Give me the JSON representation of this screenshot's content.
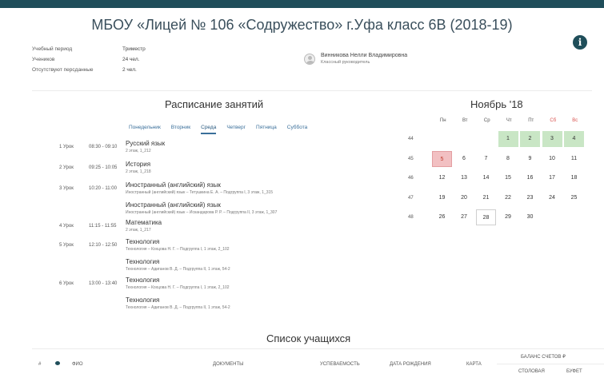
{
  "title": "МБОУ «Лицей № 106 «Содружество» г.Уфа класс 6В (2018-19)",
  "info_icon": "info-icon",
  "meta": [
    {
      "label": "Учебный период",
      "value": "Триместр"
    },
    {
      "label": "Учеников",
      "value": "24 чел."
    },
    {
      "label": "Отсутствуют персданные",
      "value": "2 чел."
    }
  ],
  "teacher": {
    "name": "Винникова Нелли Владимировна",
    "role": "Классный руководитель",
    "icon": "avatar-icon"
  },
  "schedule": {
    "title": "Расписание занятий",
    "tabs": [
      "Понедельник",
      "Вторник",
      "Среда",
      "Четверг",
      "Пятница",
      "Суббота"
    ],
    "active_tab": "Среда",
    "lessons": [
      {
        "num": "1 Урок",
        "time": "08:30 - 09:10",
        "entries": [
          {
            "name": "Русский язык",
            "detail": "2 этаж, 1_212"
          }
        ]
      },
      {
        "num": "2 Урок",
        "time": "09:25 - 10:05",
        "entries": [
          {
            "name": "История",
            "detail": "2 этаж, 1_218"
          }
        ]
      },
      {
        "num": "3 Урок",
        "time": "10:20 - 11:00",
        "entries": [
          {
            "name": "Иностранный (английский) язык",
            "detail": "Иностранный (английский) язык – Тетушкина Е. А. – Подгруппа I, 3 этаж, 1_315"
          },
          {
            "name": "Иностранный (английский) язык",
            "detail": "Иностранный (английский) язык – Искандарова Р. Р. – Подгруппа II, 3 этаж, 1_307"
          }
        ]
      },
      {
        "num": "4 Урок",
        "time": "11:15 - 11:55",
        "entries": [
          {
            "name": "Математика",
            "detail": "2 этаж, 1_217"
          }
        ]
      },
      {
        "num": "5 Урок",
        "time": "12:10 - 12:50",
        "entries": [
          {
            "name": "Технология",
            "detail": "Технология – Кохцова Н. Г. – Подгруппа I, 1 этаж, 2_102"
          },
          {
            "name": "Технология",
            "detail": "Технология – Адиганов В. Д. – Подгруппа II, 1 этаж, 54-2"
          }
        ]
      },
      {
        "num": "6 Урок",
        "time": "13:00 - 13:40",
        "entries": [
          {
            "name": "Технология",
            "detail": "Технология – Кохцова Н. Г. – Подгруппа I, 1 этаж, 2_102"
          },
          {
            "name": "Технология",
            "detail": "Технология – Адиганов В. Д. – Подгруппа II, 1 этаж, 54-2"
          }
        ]
      }
    ]
  },
  "calendar": {
    "title": "Ноябрь '18",
    "weekdays": [
      "Пн",
      "Вт",
      "Ср",
      "Чт",
      "Пт",
      "Сб",
      "Вс"
    ],
    "weekend_color": "#d9534f",
    "weeks": [
      {
        "week": "44",
        "days": [
          "",
          "",
          "",
          "1",
          "2",
          "3",
          "4"
        ],
        "green": [
          3,
          4,
          5,
          6
        ]
      },
      {
        "week": "45",
        "days": [
          "5",
          "6",
          "7",
          "8",
          "9",
          "10",
          "11"
        ],
        "red": [
          0
        ]
      },
      {
        "week": "46",
        "days": [
          "12",
          "13",
          "14",
          "15",
          "16",
          "17",
          "18"
        ]
      },
      {
        "week": "47",
        "days": [
          "19",
          "20",
          "21",
          "22",
          "23",
          "24",
          "25"
        ]
      },
      {
        "week": "48",
        "days": [
          "26",
          "27",
          "28",
          "29",
          "30",
          "",
          ""
        ],
        "today": [
          2
        ]
      }
    ]
  },
  "students": {
    "title": "Список учащихся",
    "columns": {
      "hash": "#",
      "fio": "ФИО",
      "documents": "ДОКУМЕНТЫ",
      "progress": "УСПЕВАЕМОСТЬ",
      "birth": "ДАТА РОЖДЕНИЯ",
      "card": "КАРТА",
      "balance": "БАЛАНС СЧЕТОВ ₽",
      "canteen": "СТОЛОВАЯ",
      "buffet": "БУФЕТ"
    }
  }
}
